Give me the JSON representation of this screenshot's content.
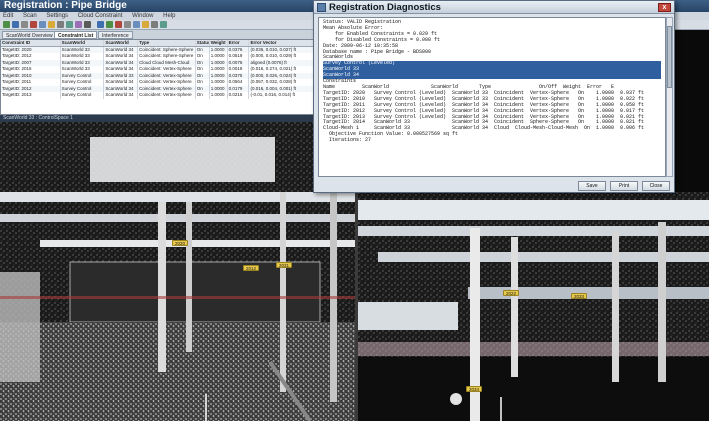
{
  "app": {
    "title": "Registration : Pipe Bridge",
    "menu": [
      "Edit",
      "Scan",
      "Settings",
      "Cloud Constraint",
      "Window",
      "Help"
    ],
    "panel_tabs": [
      "ScanWorld Overview",
      "Constraint List",
      "Interference"
    ],
    "viewport_label": "ScanWorld 33 : ControlSpace 1"
  },
  "constraint_table": {
    "headers": [
      "Constraint ID",
      "ScanWorld",
      "ScanWorld",
      "Type",
      "Status",
      "Weight",
      "Error",
      "Error Vector"
    ],
    "rows": [
      [
        "TargetID: 2020",
        "ScanWorld 33",
        "ScanWorld 34",
        "Coincident: Sphere-Sphere",
        "On",
        "1.0000",
        "0.0376",
        "(0.036, 0.010, 0.027) ft"
      ],
      [
        "TargetID: 2012",
        "ScanWorld 33",
        "ScanWorld 34",
        "Coincident: Sphere-Sphere",
        "On",
        "1.0000",
        "0.0519",
        "(0.000, 0.010, 0.029) ft"
      ],
      [
        "TargetID: 2007",
        "ScanWorld 33",
        "ScanWorld 34",
        "Cloud Cloud Mesh-Cloud",
        "On",
        "1.0000",
        "0.0076",
        "aligned (0.0076) ft"
      ],
      [
        "TargetID: 2015",
        "ScanWorld 33",
        "ScanWorld 34",
        "Coincident: Vertex-Sphere",
        "On",
        "1.0000",
        "0.0018",
        "(0.016, 0.274, 0.021) ft"
      ],
      [
        "TargetID: 2010",
        "Survey Control",
        "ScanWorld 33",
        "Coincident: Vertex-Sphere",
        "On",
        "1.0000",
        "0.0375",
        "(0.000, 0.026, 0.024) ft"
      ],
      [
        "TargetID: 2011",
        "Survey Control",
        "ScanWorld 34",
        "Coincident: Vertex-Sphere",
        "On",
        "1.0000",
        "0.0564",
        "(0.057, 0.032, 0.028) ft"
      ],
      [
        "TargetID: 2012",
        "Survey Control",
        "ScanWorld 34",
        "Coincident: Vertex-Sphere",
        "On",
        "1.0000",
        "0.0179",
        "(0.016, 0.004, 0.001) ft"
      ],
      [
        "TargetID: 2013",
        "Survey Control",
        "ScanWorld 34",
        "Coincident: Vertex-Sphere",
        "On",
        "1.0000",
        "0.0216",
        "(-0.01, 0.016, 0.014) ft"
      ]
    ]
  },
  "viewport_tags": [
    "2020",
    "2012",
    "2031",
    "2022",
    "2033",
    "2034",
    "2016",
    "2013",
    "2010"
  ],
  "dialog": {
    "title": "Registration Diagnostics",
    "close_label": "x",
    "report_lines": [
      "Status: VALID Registration",
      "",
      "Mean Absolute Error:",
      "",
      "    for Enabled Constraints = 0.029 ft",
      "",
      "    for Disabled Constraints = 0.000 ft",
      "Date: 2009-06-12 10:35:58",
      "",
      "Database name : Pipe Bridge - BDS000",
      "",
      "ScanWorlds",
      "Survey Control (Leveled)",
      "ScanWorld 33",
      "ScanWorld 34",
      "",
      "Constraints",
      "Name         ScanWorld              ScanWorld       Type                On/Off  Weight  Error   E",
      "TargetID: 2020   Survey Control (Leveled)  ScanWorld 33  Coincident  Vertex-Sphere   On    1.0000  0.037 ft",
      "TargetID: 2010   Survey Control (Leveled)  ScanWorld 33  Coincident  Vertex-Sphere   On    1.0000  0.022 ft",
      "TargetID: 2011   Survey Control (Leveled)  ScanWorld 34  Coincident  Vertex-Sphere   On    1.0000  0.058 ft",
      "TargetID: 2012   Survey Control (Leveled)  ScanWorld 34  Coincident  Vertex-Sphere   On    1.0000  0.017 ft",
      "TargetID: 2013   Survey Control (Leveled)  ScanWorld 34  Coincident  Vertex-Sphere   On    1.0000  0.021 ft",
      "TargetID: 2014   ScanWorld 33              ScanWorld 34  Coincident  Sphere-Sphere   On    1.0000  0.021 ft",
      "Cloud-Mesh 1     ScanWorld 33              ScanWorld 34  Cloud  Cloud-Mesh-Cloud-Mesh  On  1.0000  0.006 ft",
      "  Objective Function Value: 0.000527569 sq ft",
      "  Iterations: 27"
    ],
    "buttons": {
      "save": "Save",
      "print": "Print",
      "close": "Close"
    }
  },
  "colors": {
    "titlebar": "#274566",
    "tag": "#e6c84a",
    "pipe": "#e8eef4",
    "steel": "#c8c8c8"
  }
}
